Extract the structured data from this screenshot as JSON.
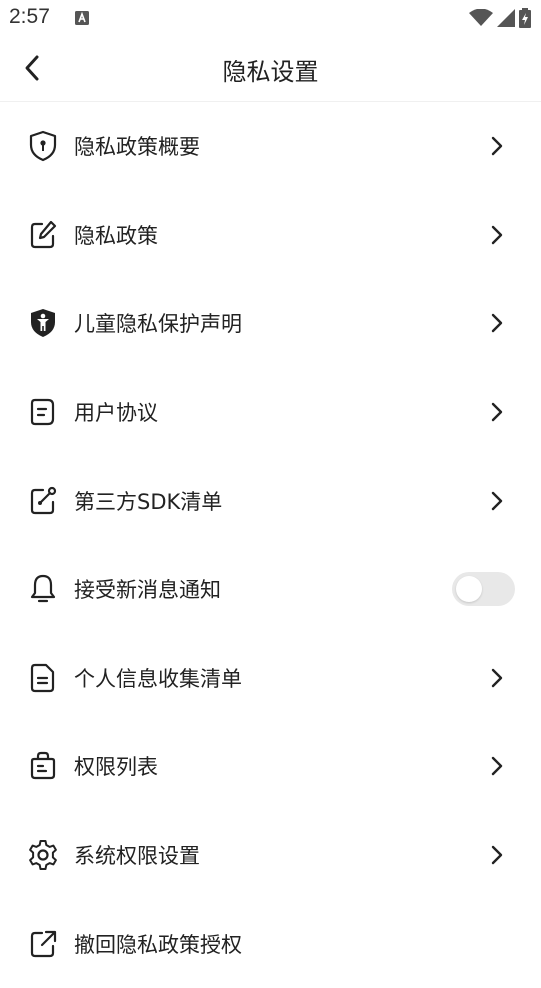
{
  "status_bar": {
    "time": "2:57",
    "notification_icon": "a-letter-icon",
    "wifi_icon": "wifi-icon",
    "signal_icon": "signal-icon",
    "battery_icon": "battery-charging-icon"
  },
  "header": {
    "back_icon": "chevron-left-icon",
    "title": "隐私设置"
  },
  "menu": {
    "items": [
      {
        "label": "隐私政策概要",
        "icon": "shield-key-icon"
      },
      {
        "label": "隐私政策",
        "icon": "edit-icon"
      },
      {
        "label": "儿童隐私保护声明",
        "icon": "child-shield-icon"
      },
      {
        "label": "用户协议",
        "icon": "document-icon"
      },
      {
        "label": "第三方SDK清单",
        "icon": "sdk-link-icon"
      },
      {
        "label": "接受新消息通知",
        "icon": "bell-icon",
        "toggle": {
          "on": false
        }
      },
      {
        "label": "个人信息收集清单",
        "icon": "file-list-icon"
      },
      {
        "label": "权限列表",
        "icon": "bag-icon"
      },
      {
        "label": "系统权限设置",
        "icon": "gear-icon"
      },
      {
        "label": "撤回隐私政策授权",
        "icon": "external-link-icon"
      }
    ]
  },
  "colors": {
    "text": "#222222",
    "toggle_off": "#e8e8e8",
    "background": "#ffffff"
  }
}
